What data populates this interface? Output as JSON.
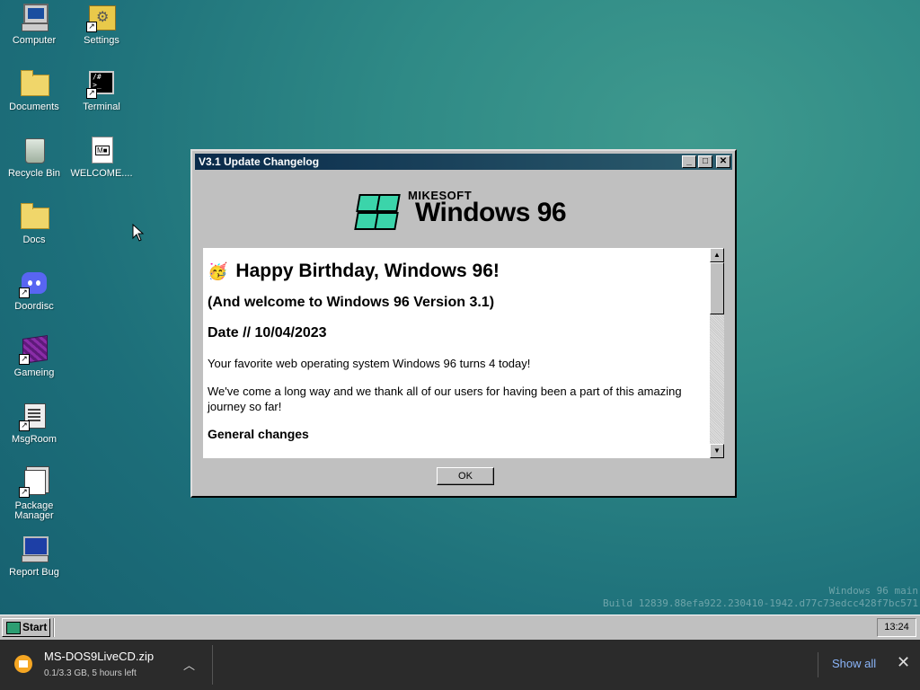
{
  "desktop": {
    "icons": [
      {
        "label": "Computer"
      },
      {
        "label": "Settings"
      },
      {
        "label": "Documents"
      },
      {
        "label": "Terminal"
      },
      {
        "label": "Recycle Bin"
      },
      {
        "label": "WELCOME...."
      },
      {
        "label": "Docs"
      },
      {
        "label": "Doordisc"
      },
      {
        "label": "Gameing"
      },
      {
        "label": "MsgRoom"
      },
      {
        "label": "Package Manager"
      },
      {
        "label": "Report Bug"
      }
    ],
    "build_line1": "Windows 96 main",
    "build_line2": "Build 12839.88efa922.230410-1942.d77c73edcc428f7bc571"
  },
  "window": {
    "title": "V3.1 Update Changelog",
    "logo_brand": "MIKESOFT",
    "logo_name": "Windows 96",
    "heading": "Happy Birthday, Windows 96!",
    "emoji": "🥳",
    "subheading": "(And welcome to Windows 96 Version 3.1)",
    "date": "Date // 10/04/2023",
    "paragraph1": "Your favorite web operating system Windows 96 turns 4 today!",
    "paragraph2": "We've come a long way and we thank all of our users for having been a part of this amazing journey so far!",
    "section": "General changes",
    "ok_label": "OK"
  },
  "taskbar": {
    "start_label": "Start",
    "clock": "13:24"
  },
  "download_bar": {
    "file_name": "MS-DOS9LiveCD.zip",
    "status": "0.1/3.3 GB, 5 hours left",
    "show_all": "Show all"
  }
}
